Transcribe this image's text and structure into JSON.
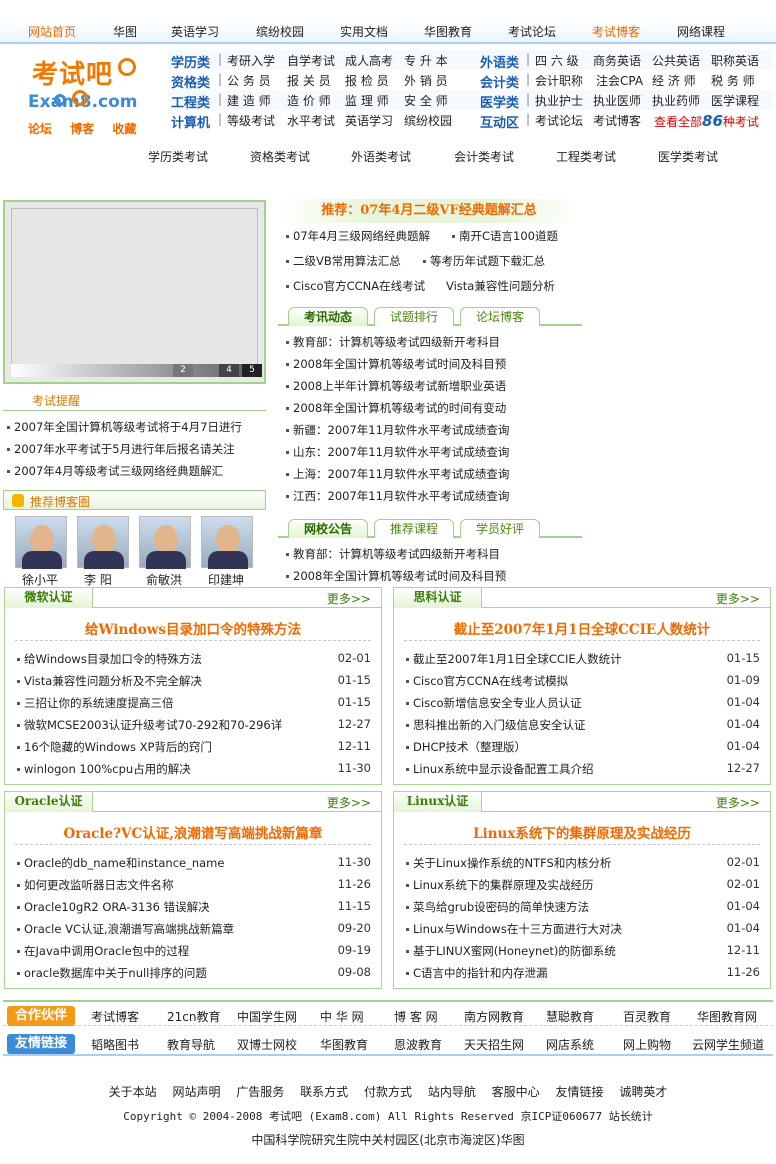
{
  "topnav": [
    "网站首页",
    "华图",
    "英语学习",
    "缤纷校园",
    "实用文档",
    "华图教育",
    "考试论坛",
    "考试博客",
    "网络课程"
  ],
  "topnav_active": "考试博客",
  "logo": {
    "main": "考试吧",
    "sub": "Exam8.com",
    "links": [
      "论坛",
      "博客",
      "收藏"
    ]
  },
  "categories": [
    {
      "title": "学历类",
      "items": [
        "考研入学",
        "自学考试",
        "成人高考",
        "专 升 本"
      ],
      "title2": "外语类",
      "items2": [
        "四 六 级",
        "商务英语",
        "公共英语",
        "职称英语"
      ]
    },
    {
      "title": "资格类",
      "items": [
        "公 务 员",
        "报 关 员",
        "报 检 员",
        "外 销 员"
      ],
      "title2": "会计类",
      "items2": [
        "会计职称",
        "注会CPA",
        "经 济 师",
        "税 务 师"
      ]
    },
    {
      "title": "工程类",
      "items": [
        "建 造 师",
        "造 价 师",
        "监 理 师",
        "安 全 师"
      ],
      "title2": "医学类",
      "items2": [
        "执业护士",
        "执业医师",
        "执业药师",
        "医学课程"
      ]
    },
    {
      "title": "计算机",
      "items": [
        "等级考试",
        "水平考试",
        "英语学习",
        "缤纷校园"
      ],
      "title2": "互动区",
      "items2": [
        "考试论坛",
        "考试博客"
      ],
      "all_pre": "查看全部",
      "all_num": "86",
      "all_post": "种考试"
    }
  ],
  "subnav": [
    "学历类考试",
    "资格类考试",
    "外语类考试",
    "会计类考试",
    "工程类考试",
    "医学类考试"
  ],
  "slider_nums": [
    "2",
    "4",
    "5"
  ],
  "remind": {
    "title": "考试提醒",
    "items": [
      "2007年全国计算机等级考试将于4月7日进行",
      "2007年水平考试于5月进行年后报名请关注",
      "2007年4月等级考试三级网络经典题解汇"
    ]
  },
  "blog": {
    "title": "推荐博客圈",
    "names": [
      "徐小平",
      "李 阳",
      "俞敏洪",
      "印建坤"
    ]
  },
  "recommend": {
    "title": "推荐：07年4月二级VF经典题解汇总",
    "lines": [
      [
        "07年4月三级网络经典题解",
        "南开C语言100道题"
      ],
      [
        "二级VB常用算法汇总",
        "等考历年试题下载汇总"
      ],
      [
        "Cisco官方CCNA在线考试",
        "Vista兼容性问题分析"
      ]
    ]
  },
  "tabs1": [
    "考讯动态",
    "试题排行",
    "论坛博客"
  ],
  "news1": [
    "教育部：计算机等级考试四级新开考科目",
    "2008年全国计算机等级考试时间及科目预",
    "2008上半年计算机等级考试新增职业英语",
    "2008年全国计算机等级考试的时间有变动",
    "新疆：2007年11月软件水平考试成绩查询",
    "山东：2007年11月软件水平考试成绩查询",
    "上海：2007年11月软件水平考试成绩查询",
    "江西：2007年11月软件水平考试成绩查询"
  ],
  "tabs2": [
    "网校公告",
    "推荐课程",
    "学员好评"
  ],
  "news2": [
    "教育部：计算机等级考试四级新开考科目",
    "2008年全国计算机等级考试时间及科目预"
  ],
  "more": "更多>>",
  "sections": [
    {
      "title": "微软认证",
      "headline": "给Windows目录加口令的特殊方法",
      "rows": [
        [
          "给Windows目录加口令的特殊方法",
          "02-01"
        ],
        [
          "Vista兼容性问题分析及不完全解决",
          "01-15"
        ],
        [
          "三招让你的系统速度提高三倍",
          "01-15"
        ],
        [
          "微软MCSE2003认证升级考试70-292和70-296详",
          "12-27"
        ],
        [
          "16个隐藏的Windows XP背后的窍门",
          "12-11"
        ],
        [
          "winlogon 100%cpu占用的解决",
          "11-30"
        ]
      ]
    },
    {
      "title": "思科认证",
      "headline": "截止至2007年1月1日全球CCIE人数统计",
      "rows": [
        [
          "截止至2007年1月1日全球CCIE人数统计",
          "01-15"
        ],
        [
          "Cisco官方CCNA在线考试模拟",
          "01-09"
        ],
        [
          "Cisco新增信息安全专业人员认证",
          "01-04"
        ],
        [
          "思科推出新的入门级信息安全认证",
          "01-04"
        ],
        [
          "DHCP技术（整理版）",
          "01-04"
        ],
        [
          "Linux系统中显示设备配置工具介绍",
          "12-27"
        ]
      ]
    },
    {
      "title": "Oracle认证",
      "headline": "Oracle?VC认证,浪潮谱写高端挑战新篇章",
      "rows": [
        [
          "Oracle的db_name和instance_name",
          "11-30"
        ],
        [
          "如何更改监听器日志文件名称",
          "11-26"
        ],
        [
          "Oracle10gR2 ORA-3136 错误解决",
          "11-15"
        ],
        [
          "Oracle VC认证,浪潮谱写高端挑战新篇章",
          "09-20"
        ],
        [
          "在Java中调用Oracle包中的过程",
          "09-19"
        ],
        [
          "oracle数据库中关于null排序的问题",
          "09-08"
        ]
      ]
    },
    {
      "title": "Linux认证",
      "headline": "Linux系统下的集群原理及实战经历",
      "rows": [
        [
          "关于Linux操作系统的NTFS和内核分析",
          "02-01"
        ],
        [
          "Linux系统下的集群原理及实战经历",
          "02-01"
        ],
        [
          "菜鸟给grub设密码的简单快速方法",
          "01-04"
        ],
        [
          "Linux与Windows在十三方面进行大对决",
          "01-04"
        ],
        [
          "基于LINUX蜜网(Honeynet)的防御系统",
          "12-11"
        ],
        [
          "C语言中的指针和内存泄漏",
          "11-26"
        ]
      ]
    }
  ],
  "partners": {
    "badge": "合作伙伴",
    "items": [
      "考试博客",
      "21cn教育",
      "中国学生网",
      "中 华 网",
      "博 客 网",
      "南方网教育",
      "慧聪教育",
      "百灵教育",
      "华图教育网"
    ]
  },
  "friends": {
    "badge": "友情链接",
    "items": [
      "韬略图书",
      "教育导航",
      "双博士网校",
      "华图教育",
      "恩波教育",
      "天天招生网",
      "网店系统",
      "网上购物",
      "云网学生频道"
    ]
  },
  "footer": {
    "links": [
      "关于本站",
      "网站声明",
      "广告服务",
      "联系方式",
      "付款方式",
      "站内导航",
      "客服中心",
      "友情链接",
      "诚聘英才"
    ],
    "copy": "Copyright © 2004-2008 考试吧 (Exam8.com) All Rights Reserved 京ICP证060677 站长统计",
    "addr": "中国科学院研究生院中关村园区(北京市海淀区)华图"
  },
  "colors": {
    "accent": "#f06a00",
    "green": "#9fd38a",
    "blue": "#1a5fb5",
    "partner_badge": "#f39a16",
    "friend_badge": "#3b8bd6"
  }
}
